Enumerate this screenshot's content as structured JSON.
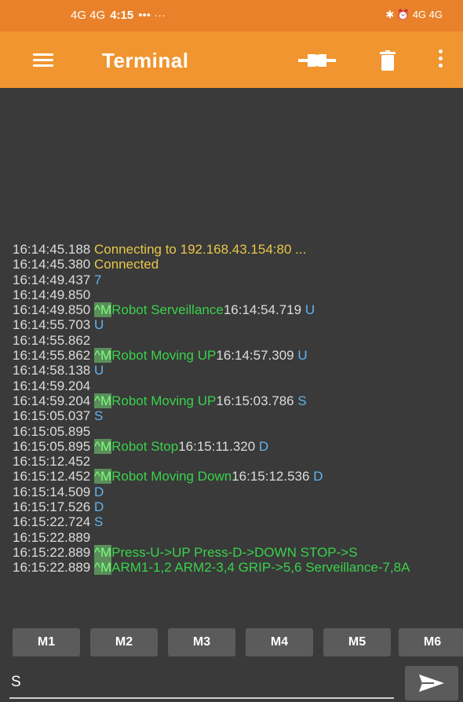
{
  "status_bar": {
    "time": "4:15",
    "signal_left": "4G 4G",
    "extra": "••• ···",
    "right": "✱ ⏰ 4G 4G"
  },
  "app_bar": {
    "title": "Terminal",
    "icons": [
      "menu-icon",
      "connect-icon",
      "trash-icon",
      "more-icon"
    ]
  },
  "terminal": {
    "lines": [
      [
        {
          "t": "16:14:45.188 ",
          "c": "ts"
        },
        {
          "t": "Connecting to 192.168.43.154:80 ...",
          "c": "yel"
        }
      ],
      [
        {
          "t": "16:14:45.380 ",
          "c": "ts"
        },
        {
          "t": "Connected",
          "c": "yel"
        }
      ],
      [
        {
          "t": "16:14:49.437 ",
          "c": "ts"
        },
        {
          "t": "7",
          "c": "blu"
        }
      ],
      [
        {
          "t": "16:14:49.850",
          "c": "ts"
        }
      ],
      [
        {
          "t": "16:14:49.850 ",
          "c": "ts"
        },
        {
          "t": "^M",
          "c": "ctrl"
        },
        {
          "t": "Robot Serveillance",
          "c": "grn"
        },
        {
          "t": "16:14:54.719 ",
          "c": "ts"
        },
        {
          "t": "U",
          "c": "blu"
        }
      ],
      [
        {
          "t": "16:14:55.703 ",
          "c": "ts"
        },
        {
          "t": "U",
          "c": "blu"
        }
      ],
      [
        {
          "t": "16:14:55.862",
          "c": "ts"
        }
      ],
      [
        {
          "t": "16:14:55.862 ",
          "c": "ts"
        },
        {
          "t": "^M",
          "c": "ctrl"
        },
        {
          "t": "Robot Moving UP",
          "c": "grn"
        },
        {
          "t": "16:14:57.309 ",
          "c": "ts"
        },
        {
          "t": "U",
          "c": "blu"
        }
      ],
      [
        {
          "t": "16:14:58.138 ",
          "c": "ts"
        },
        {
          "t": "U",
          "c": "blu"
        }
      ],
      [
        {
          "t": "16:14:59.204",
          "c": "ts"
        }
      ],
      [
        {
          "t": "16:14:59.204 ",
          "c": "ts"
        },
        {
          "t": "^M",
          "c": "ctrl"
        },
        {
          "t": "Robot Moving UP",
          "c": "grn"
        },
        {
          "t": "16:15:03.786 ",
          "c": "ts"
        },
        {
          "t": "S",
          "c": "blu"
        }
      ],
      [
        {
          "t": "16:15:05.037 ",
          "c": "ts"
        },
        {
          "t": "S",
          "c": "blu"
        }
      ],
      [
        {
          "t": "16:15:05.895",
          "c": "ts"
        }
      ],
      [
        {
          "t": "16:15:05.895 ",
          "c": "ts"
        },
        {
          "t": "^M",
          "c": "ctrl"
        },
        {
          "t": "Robot Stop",
          "c": "grn"
        },
        {
          "t": "16:15:11.320 ",
          "c": "ts"
        },
        {
          "t": "D",
          "c": "blu"
        }
      ],
      [
        {
          "t": "16:15:12.452",
          "c": "ts"
        }
      ],
      [
        {
          "t": "16:15:12.452 ",
          "c": "ts"
        },
        {
          "t": "^M",
          "c": "ctrl"
        },
        {
          "t": "Robot Moving Down",
          "c": "grn"
        },
        {
          "t": "16:15:12.536 ",
          "c": "ts"
        },
        {
          "t": "D",
          "c": "blu"
        }
      ],
      [
        {
          "t": "16:15:14.509 ",
          "c": "ts"
        },
        {
          "t": "D",
          "c": "blu"
        }
      ],
      [
        {
          "t": "16:15:17.526 ",
          "c": "ts"
        },
        {
          "t": "D",
          "c": "blu"
        }
      ],
      [
        {
          "t": "16:15:22.724 ",
          "c": "ts"
        },
        {
          "t": "S",
          "c": "blu"
        }
      ],
      [
        {
          "t": "16:15:22.889",
          "c": "ts"
        }
      ],
      [
        {
          "t": "16:15:22.889 ",
          "c": "ts"
        },
        {
          "t": "^M",
          "c": "ctrl"
        },
        {
          "t": "Press-U->UP Press-D->DOWN STOP->S",
          "c": "grn"
        }
      ],
      [
        {
          "t": "16:15:22.889 ",
          "c": "ts"
        },
        {
          "t": "^M",
          "c": "ctrl"
        },
        {
          "t": "ARM1-1,2 ARM2-3,4 GRIP->5,6 Serveillance-7,8A",
          "c": "grn"
        }
      ]
    ]
  },
  "macros": [
    "M1",
    "M2",
    "M3",
    "M4",
    "M5",
    "M6"
  ],
  "input": {
    "value": "S"
  },
  "colors": {
    "status_bar": "#e8812a",
    "app_bar": "#f0952f",
    "terminal_bg": "#3a3a3a",
    "button_bg": "#5b5b5b",
    "timestamp": "#dcdcdc",
    "status_text": "#e8c64a",
    "sent_text": "#5fb4ee",
    "received_text": "#39d24a"
  }
}
